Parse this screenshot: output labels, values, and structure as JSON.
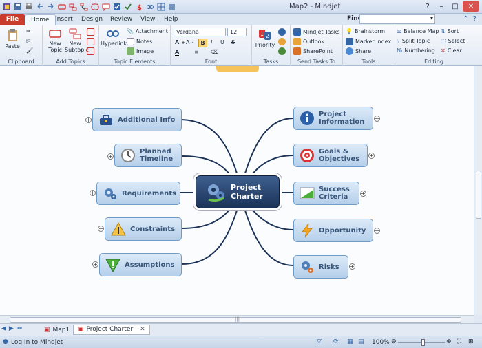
{
  "window": {
    "title": "Map2 - Mindjet",
    "minimize": "–",
    "maximize": "□",
    "close": "✕"
  },
  "tabs": [
    "File",
    "Home",
    "Insert",
    "Design",
    "Review",
    "View",
    "Help"
  ],
  "find": {
    "label": "Find:",
    "value": ""
  },
  "ribbon": {
    "clipboard": {
      "label": "Clipboard",
      "paste": "Paste"
    },
    "add_topics": {
      "label": "Add Topics",
      "new_topic": "New Topic",
      "new_subtopic": "New Subtopic"
    },
    "topic_elements": {
      "label": "Topic Elements",
      "hyperlink": "Hyperlink",
      "attachment": "Attachment",
      "notes": "Notes",
      "image": "Image"
    },
    "font": {
      "label": "Font",
      "family": "Verdana",
      "size": "12",
      "bold": "B",
      "italic": "I",
      "underline": "U",
      "strike": "S"
    },
    "tasks": {
      "label": "Tasks",
      "priority": "Priority"
    },
    "send_tasks": {
      "label": "Send Tasks To",
      "mindjet_tasks": "Mindjet Tasks",
      "outlook": "Outlook",
      "sharepoint": "SharePoint"
    },
    "tools": {
      "label": "Tools",
      "brainstorm": "Brainstorm",
      "marker_index": "Marker Index",
      "share": "Share"
    },
    "editing": {
      "label": "Editing",
      "balance_map": "Balance Map",
      "sort": "Sort",
      "split_topic": "Split Topic",
      "select": "Select",
      "numbering": "Numbering",
      "clear": "Clear"
    }
  },
  "map": {
    "central": {
      "line1": "Project",
      "line2": "Charter"
    },
    "left": [
      {
        "line1": "Additional Info",
        "line2": ""
      },
      {
        "line1": "Planned",
        "line2": "Timeline"
      },
      {
        "line1": "Requirements",
        "line2": ""
      },
      {
        "line1": "Constraints",
        "line2": ""
      },
      {
        "line1": "Assumptions",
        "line2": ""
      }
    ],
    "right": [
      {
        "line1": "Project",
        "line2": "Information"
      },
      {
        "line1": "Goals &",
        "line2": "Objectives"
      },
      {
        "line1": "Success",
        "line2": "Criteria"
      },
      {
        "line1": "Opportunity",
        "line2": ""
      },
      {
        "line1": "Risks",
        "line2": ""
      }
    ],
    "expand": "+"
  },
  "sheets": [
    "Map1",
    "Project Charter"
  ],
  "sheet_close": "✕",
  "status": {
    "login": "Log In to Mindjet",
    "zoom": "100%"
  },
  "scroll_grip": "|||"
}
